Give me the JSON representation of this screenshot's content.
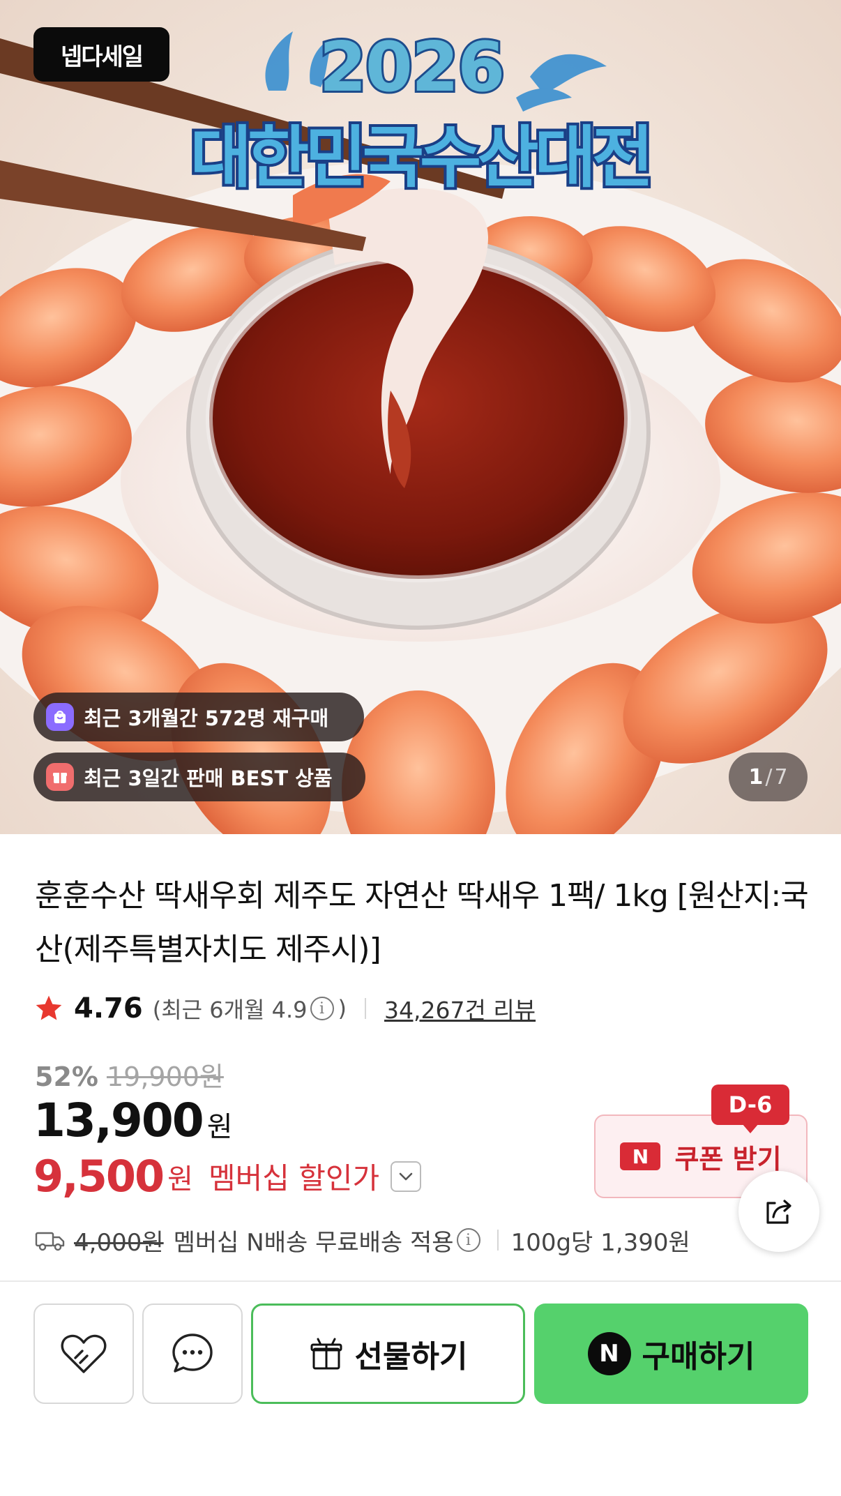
{
  "hero": {
    "brand_badge": "넵다세일",
    "event_year": "2026",
    "event_title": "대한민국수산대전",
    "badges": [
      {
        "icon": "shopping-bag-icon",
        "text": "최근 3개월간 572명 재구매"
      },
      {
        "icon": "gift-box-icon",
        "text": "최근 3일간 판매 BEST 상품"
      }
    ],
    "image_counter": {
      "current": "1",
      "separator": "/",
      "total": "7"
    }
  },
  "product": {
    "title": "훈훈수산 딱새우회 제주도 자연산 딱새우 1팩/ 1kg [원산지:국산(제주특별자치도 제주시)]",
    "rating": {
      "score": "4.76",
      "recent_prefix": "(최근 6개월 4.9",
      "recent_suffix": ")",
      "review_count": "34,267건 리뷰"
    },
    "price": {
      "discount_rate": "52%",
      "original": "19,900원",
      "sale_amount": "13,900",
      "currency": "원",
      "member_amount": "9,500",
      "member_label": "멤버십 할인가"
    },
    "coupon": {
      "dday": "D-6",
      "logo": "N",
      "label": "쿠폰 받기"
    },
    "delivery": {
      "old_fee": "4,000원",
      "text": "멤버십 N배송 무료배송 적용",
      "unit_price": "100g당 1,390원"
    }
  },
  "actions": {
    "gift_label": "선물하기",
    "buy_logo": "N",
    "buy_label": "구매하기"
  },
  "colors": {
    "accent_red": "#d6323b",
    "buy_green": "#55d16c",
    "gift_border": "#4bbd5a",
    "star": "#e8382f"
  }
}
